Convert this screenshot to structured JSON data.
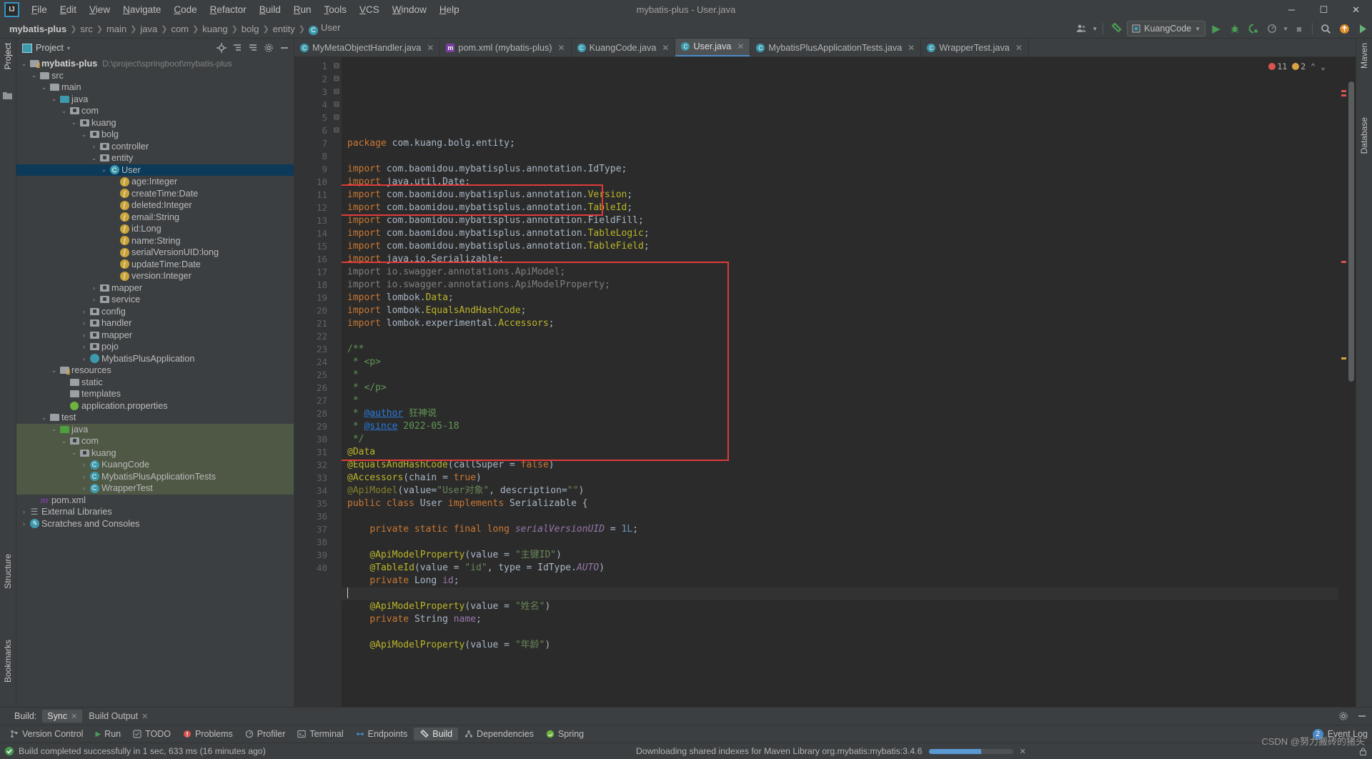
{
  "window": {
    "title": "mybatis-plus - User.java",
    "min": "─",
    "max": "☐",
    "close": "✕"
  },
  "menubar": {
    "logo": "IJ",
    "items": [
      "File",
      "Edit",
      "View",
      "Navigate",
      "Code",
      "Refactor",
      "Build",
      "Run",
      "Tools",
      "VCS",
      "Window",
      "Help"
    ]
  },
  "breadcrumb": {
    "segments": [
      {
        "label": "mybatis-plus",
        "bold": true,
        "icon": ""
      },
      {
        "label": "src",
        "bold": false,
        "icon": ""
      },
      {
        "label": "main",
        "bold": false,
        "icon": ""
      },
      {
        "label": "java",
        "bold": false,
        "icon": ""
      },
      {
        "label": "com",
        "bold": false,
        "icon": ""
      },
      {
        "label": "kuang",
        "bold": false,
        "icon": ""
      },
      {
        "label": "bolg",
        "bold": false,
        "icon": ""
      },
      {
        "label": "entity",
        "bold": false,
        "icon": ""
      },
      {
        "label": "User",
        "bold": false,
        "icon": "class-icon"
      }
    ],
    "separator": "❯"
  },
  "toolbar": {
    "avatar_icon": "user-group-icon",
    "hammer_icon": "build-hammer-icon",
    "run_config": "KuangCode",
    "run_config_icon": "run-config-icon",
    "chevron": "▾",
    "run_icon": "▶",
    "debug_icon": "debug-bug-icon",
    "coverage_icon": "run-coverage-icon",
    "profile_icon": "profiler-icon",
    "stop_icon": "■",
    "search_icon": "⌕",
    "updates_icon": "update-icon",
    "ide_icon": "ide-features-icon"
  },
  "project_panel": {
    "title": "Project",
    "chevron": "▾",
    "actions": [
      "locate-icon",
      "collapse-all-icon",
      "expand-icon",
      "settings-gear-icon",
      "hide-panel-icon"
    ],
    "tree": [
      {
        "depth": 0,
        "arrow": "v",
        "icon": "module-folder",
        "label": "mybatis-plus",
        "bold": true,
        "path": "D:\\project\\springboot\\mybatis-plus",
        "state": "normal"
      },
      {
        "depth": 1,
        "arrow": "v",
        "icon": "folder",
        "label": "src",
        "state": "normal"
      },
      {
        "depth": 2,
        "arrow": "v",
        "icon": "folder",
        "label": "main",
        "state": "normal"
      },
      {
        "depth": 3,
        "arrow": "v",
        "icon": "folder-blue",
        "label": "java",
        "state": "normal"
      },
      {
        "depth": 4,
        "arrow": "v",
        "icon": "package",
        "label": "com",
        "state": "normal"
      },
      {
        "depth": 5,
        "arrow": "v",
        "icon": "package",
        "label": "kuang",
        "state": "normal"
      },
      {
        "depth": 6,
        "arrow": "v",
        "icon": "package",
        "label": "bolg",
        "state": "normal"
      },
      {
        "depth": 7,
        "arrow": ">",
        "icon": "package",
        "label": "controller",
        "state": "normal"
      },
      {
        "depth": 7,
        "arrow": "v",
        "icon": "package",
        "label": "entity",
        "state": "normal"
      },
      {
        "depth": 8,
        "arrow": "v",
        "icon": "class",
        "label": "User",
        "state": "selected"
      },
      {
        "depth": 9,
        "arrow": "",
        "icon": "field",
        "label": "age:Integer",
        "state": "normal"
      },
      {
        "depth": 9,
        "arrow": "",
        "icon": "field",
        "label": "createTime:Date",
        "state": "normal"
      },
      {
        "depth": 9,
        "arrow": "",
        "icon": "field",
        "label": "deleted:Integer",
        "state": "normal"
      },
      {
        "depth": 9,
        "arrow": "",
        "icon": "field",
        "label": "email:String",
        "state": "normal"
      },
      {
        "depth": 9,
        "arrow": "",
        "icon": "field",
        "label": "id:Long",
        "state": "normal"
      },
      {
        "depth": 9,
        "arrow": "",
        "icon": "field",
        "label": "name:String",
        "state": "normal"
      },
      {
        "depth": 9,
        "arrow": "",
        "icon": "field-static",
        "label": "serialVersionUID:long",
        "state": "normal"
      },
      {
        "depth": 9,
        "arrow": "",
        "icon": "field",
        "label": "updateTime:Date",
        "state": "normal"
      },
      {
        "depth": 9,
        "arrow": "",
        "icon": "field",
        "label": "version:Integer",
        "state": "normal"
      },
      {
        "depth": 7,
        "arrow": ">",
        "icon": "package",
        "label": "mapper",
        "state": "normal"
      },
      {
        "depth": 7,
        "arrow": ">",
        "icon": "package",
        "label": "service",
        "state": "normal"
      },
      {
        "depth": 6,
        "arrow": ">",
        "icon": "package",
        "label": "config",
        "state": "normal"
      },
      {
        "depth": 6,
        "arrow": ">",
        "icon": "package",
        "label": "handler",
        "state": "normal"
      },
      {
        "depth": 6,
        "arrow": ">",
        "icon": "package",
        "label": "mapper",
        "state": "normal"
      },
      {
        "depth": 6,
        "arrow": ">",
        "icon": "package",
        "label": "pojo",
        "state": "normal"
      },
      {
        "depth": 6,
        "arrow": ">",
        "icon": "spring-class",
        "label": "MybatisPlusApplication",
        "state": "normal"
      },
      {
        "depth": 3,
        "arrow": "v",
        "icon": "resources-folder",
        "label": "resources",
        "state": "normal"
      },
      {
        "depth": 4,
        "arrow": "",
        "icon": "folder",
        "label": "static",
        "state": "normal"
      },
      {
        "depth": 4,
        "arrow": "",
        "icon": "folder",
        "label": "templates",
        "state": "normal"
      },
      {
        "depth": 4,
        "arrow": "",
        "icon": "properties-file",
        "label": "application.properties",
        "state": "normal"
      },
      {
        "depth": 2,
        "arrow": "v",
        "icon": "folder",
        "label": "test",
        "state": "normal"
      },
      {
        "depth": 3,
        "arrow": "v",
        "icon": "folder-green",
        "label": "java",
        "state": "modified"
      },
      {
        "depth": 4,
        "arrow": "v",
        "icon": "package",
        "label": "com",
        "state": "modified"
      },
      {
        "depth": 5,
        "arrow": "v",
        "icon": "package",
        "label": "kuang",
        "state": "modified"
      },
      {
        "depth": 6,
        "arrow": ">",
        "icon": "class",
        "label": "KuangCode",
        "state": "modified"
      },
      {
        "depth": 6,
        "arrow": ">",
        "icon": "class",
        "label": "MybatisPlusApplicationTests",
        "state": "modified"
      },
      {
        "depth": 6,
        "arrow": ">",
        "icon": "class",
        "label": "WrapperTest",
        "state": "modified"
      },
      {
        "depth": 1,
        "arrow": "",
        "icon": "maven-file",
        "label": "pom.xml",
        "state": "normal"
      },
      {
        "depth": 0,
        "arrow": ">",
        "icon": "libraries",
        "label": "External Libraries",
        "state": "normal"
      },
      {
        "depth": 0,
        "arrow": ">",
        "icon": "scratches",
        "label": "Scratches and Consoles",
        "state": "normal"
      }
    ]
  },
  "left_rail": {
    "project": "Project",
    "structure": "Structure",
    "bookmarks": "Bookmarks"
  },
  "right_rail": {
    "maven": "Maven",
    "database": "Database"
  },
  "editor_tabs": [
    {
      "label": "MyMetaObjectHandler.java",
      "icon": "class-icon",
      "active": false,
      "close": "✕"
    },
    {
      "label": "pom.xml (mybatis-plus)",
      "icon": "maven-icon",
      "active": false,
      "close": "✕"
    },
    {
      "label": "KuangCode.java",
      "icon": "class-icon",
      "active": false,
      "close": "✕"
    },
    {
      "label": "User.java",
      "icon": "class-icon",
      "active": true,
      "close": "✕"
    },
    {
      "label": "MybatisPlusApplicationTests.java",
      "icon": "class-icon",
      "active": false,
      "close": "✕"
    },
    {
      "label": "WrapperTest.java",
      "icon": "class-icon",
      "active": false,
      "close": "✕"
    }
  ],
  "inspections": {
    "errors": "11",
    "warnings": "2",
    "up": "⌃",
    "down": "⌄"
  },
  "code": {
    "first_line": 1,
    "lines": [
      {
        "n": 1,
        "fold": "",
        "html": "<span class=\"kw\">package</span> com.kuang.bolg.entity;"
      },
      {
        "n": 2,
        "fold": "",
        "html": ""
      },
      {
        "n": 3,
        "fold": "-",
        "html": "<span class=\"kw\">import</span> com.baomidou.mybatisplus.annotation.<span class=\"typ\">IdType</span>;"
      },
      {
        "n": 4,
        "fold": "",
        "html": "<span class=\"kw\">import</span> java.util.<span class=\"typ\">Date</span>;"
      },
      {
        "n": 5,
        "fold": "",
        "html": "<span class=\"kw\">import</span> com.baomidou.mybatisplus.annotation.<span class=\"ann\">Version</span>;"
      },
      {
        "n": 6,
        "fold": "",
        "html": "<span class=\"kw\">import</span> com.baomidou.mybatisplus.annotation.<span class=\"ann\">TableId</span>;"
      },
      {
        "n": 7,
        "fold": "",
        "html": "<span class=\"kw\">import</span> com.baomidou.mybatisplus.annotation.<span class=\"typ\">FieldFill</span>;"
      },
      {
        "n": 8,
        "fold": "",
        "html": "<span class=\"kw\">import</span> com.baomidou.mybatisplus.annotation.<span class=\"ann\">TableLogic</span>;"
      },
      {
        "n": 9,
        "fold": "",
        "html": "<span class=\"kw\">import</span> com.baomidou.mybatisplus.annotation.<span class=\"ann\">TableField</span>;"
      },
      {
        "n": 10,
        "fold": "",
        "html": "<span class=\"kw\">import</span> java.io.<span class=\"typ\">Serializable</span>;"
      },
      {
        "n": 11,
        "fold": "",
        "html": "<span class=\"grey\">import io.swagger.annotations.ApiModel;</span>"
      },
      {
        "n": 12,
        "fold": "",
        "html": "<span class=\"grey\">import io.swagger.annotations.ApiModelProperty;</span>"
      },
      {
        "n": 13,
        "fold": "",
        "html": "<span class=\"kw\">import</span> lombok.<span class=\"ann\">Data</span>;"
      },
      {
        "n": 14,
        "fold": "",
        "html": "<span class=\"kw\">import</span> lombok.<span class=\"ann\">EqualsAndHashCode</span>;"
      },
      {
        "n": 15,
        "fold": "-",
        "html": "<span class=\"kw\">import</span> lombok.experimental.<span class=\"ann\">Accessors</span>;"
      },
      {
        "n": 16,
        "fold": "",
        "html": ""
      },
      {
        "n": 17,
        "fold": "-",
        "html": "<span class=\"doc\">/**</span>"
      },
      {
        "n": 18,
        "fold": "",
        "html": " <span class=\"doc\">* &lt;p&gt;</span>"
      },
      {
        "n": 19,
        "fold": "",
        "html": " <span class=\"doc\">*</span>"
      },
      {
        "n": 20,
        "fold": "",
        "html": " <span class=\"doc\">* &lt;/p&gt;</span>"
      },
      {
        "n": 21,
        "fold": "",
        "html": " <span class=\"doc\">*</span>"
      },
      {
        "n": 22,
        "fold": "",
        "html": " <span class=\"doc\">* <span style=\"color:#287bde;text-decoration:underline\">@author</span> <span style=\"color:#629755\">狂神说</span></span>"
      },
      {
        "n": 23,
        "fold": "",
        "html": " <span class=\"doc\">* <span style=\"color:#287bde;text-decoration:underline\">@since</span> <span style=\"color:#629755\">2022-05-18</span></span>"
      },
      {
        "n": 24,
        "fold": "",
        "html": " <span class=\"doc\">*/</span>"
      },
      {
        "n": 25,
        "fold": "-",
        "html": "<span class=\"ann\">@Data</span>"
      },
      {
        "n": 26,
        "fold": "",
        "html": "<span class=\"ann\">@EqualsAndHashCode</span>(callSuper = <span class=\"kw\">false</span>)"
      },
      {
        "n": 27,
        "fold": "",
        "html": "<span class=\"ann\">@Accessors</span>(chain = <span class=\"kw\">true</span>)"
      },
      {
        "n": 28,
        "fold": "",
        "html": "<span class=\"ann\" style=\"opacity:.62\">@ApiModel</span>(value=<span class=\"str\">\"User对象\"</span>, description=<span class=\"str\">\"\"</span>)"
      },
      {
        "n": 29,
        "fold": "",
        "html": "<span class=\"kw\">public class</span> User <span class=\"kw\">implements</span> <span class=\"typ\">Serializable</span> {"
      },
      {
        "n": 30,
        "fold": "",
        "html": ""
      },
      {
        "n": 31,
        "fold": "",
        "html": "    <span class=\"kw\">private static final</span> <span class=\"kw\">long</span> <span class=\"stat\">serialVersionUID</span> = <span class=\"num\">1L</span>;"
      },
      {
        "n": 32,
        "fold": "",
        "html": ""
      },
      {
        "n": 33,
        "fold": "-",
        "html": "    <span class=\"ann\">@ApiModelProperty</span>(value = <span class=\"str\">\"主键ID\"</span>)"
      },
      {
        "n": 34,
        "fold": "=",
        "html": "    <span class=\"ann\">@TableId</span>(value = <span class=\"str\">\"id\"</span>, type = IdType.<span class=\"stat\">AUTO</span>)"
      },
      {
        "n": 35,
        "fold": "",
        "html": "    <span class=\"kw\">private</span> <span class=\"typ\">Long</span> <span class=\"fld\">id</span>;"
      },
      {
        "n": 36,
        "fold": "",
        "html": "<span class=\"caretslot\"></span>"
      },
      {
        "n": 37,
        "fold": "",
        "html": "    <span class=\"ann\">@ApiModelProperty</span>(value = <span class=\"str\">\"姓名\"</span>)"
      },
      {
        "n": 38,
        "fold": "",
        "html": "    <span class=\"kw\">private</span> <span class=\"typ\">String</span> <span class=\"fld\">name</span>;"
      },
      {
        "n": 39,
        "fold": "",
        "html": ""
      },
      {
        "n": 40,
        "fold": "",
        "html": "    <span class=\"ann\">@ApiModelProperty</span>(value = <span class=\"str\">\"年龄\"</span>)"
      }
    ]
  },
  "build_bar": {
    "label": "Build:",
    "tabs": [
      {
        "label": "Sync",
        "active": true,
        "close": "✕"
      },
      {
        "label": "Build Output",
        "active": false,
        "close": "✕"
      }
    ],
    "actions": [
      "settings-gear-icon",
      "minimize-icon"
    ]
  },
  "tool_windows": {
    "items": [
      {
        "label": "Version Control",
        "icon": "branch-icon",
        "active": false
      },
      {
        "label": "Run",
        "icon": "run-icon",
        "active": false
      },
      {
        "label": "TODO",
        "icon": "todo-icon",
        "active": false
      },
      {
        "label": "Problems",
        "icon": "problems-icon",
        "active": false
      },
      {
        "label": "Profiler",
        "icon": "profiler-icon",
        "active": false
      },
      {
        "label": "Terminal",
        "icon": "terminal-icon",
        "active": false
      },
      {
        "label": "Endpoints",
        "icon": "endpoints-icon",
        "active": false
      },
      {
        "label": "Build",
        "icon": "build-icon",
        "active": true
      },
      {
        "label": "Dependencies",
        "icon": "dependencies-icon",
        "active": false
      },
      {
        "label": "Spring",
        "icon": "spring-icon",
        "active": false
      }
    ],
    "event_log": "Event Log",
    "event_log_badge": "2"
  },
  "status_bar": {
    "message": "Build completed successfully in 1 sec, 633 ms (16 minutes ago)",
    "indexing": "Downloading shared indexes for Maven Library org.mybatis:mybatis:3.4.6",
    "progress": 62,
    "stop_icon": "✕",
    "watermark": "CSDN @努力搬砖的猪头"
  },
  "colors": {
    "accent": "#4a88c7",
    "selection": "#0d3a58",
    "modified": "#4e5844",
    "highlight_box": "#e03a3a",
    "editor_bg": "#2b2b2b",
    "panel_bg": "#3c3f41"
  }
}
